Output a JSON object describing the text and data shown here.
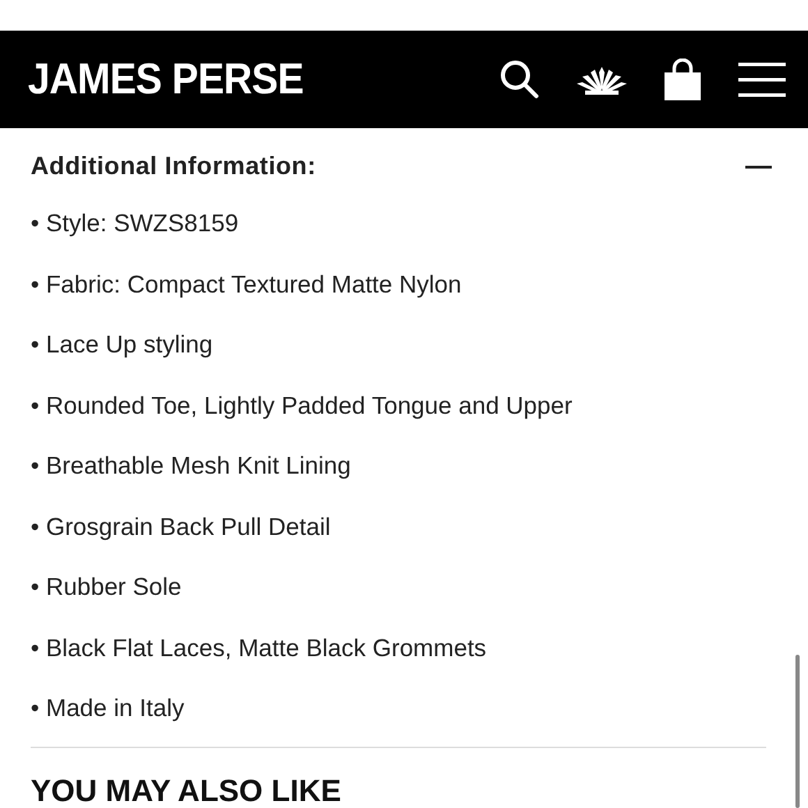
{
  "header": {
    "brand": "JAMES PERSE"
  },
  "section": {
    "title": "Additional Information:",
    "expanded": true,
    "items": [
      "• Style: SWZS8159",
      "• Fabric: Compact Textured Matte Nylon",
      "• Lace Up styling",
      "• Rounded Toe, Lightly Padded Tongue and Upper",
      "• Breathable Mesh Knit Lining",
      "• Grosgrain Back Pull Detail",
      "• Rubber Sole",
      "• Black Flat Laces, Matte Black Grommets",
      "• Made in Italy"
    ]
  },
  "related": {
    "title": "YOU MAY ALSO LIKE"
  }
}
